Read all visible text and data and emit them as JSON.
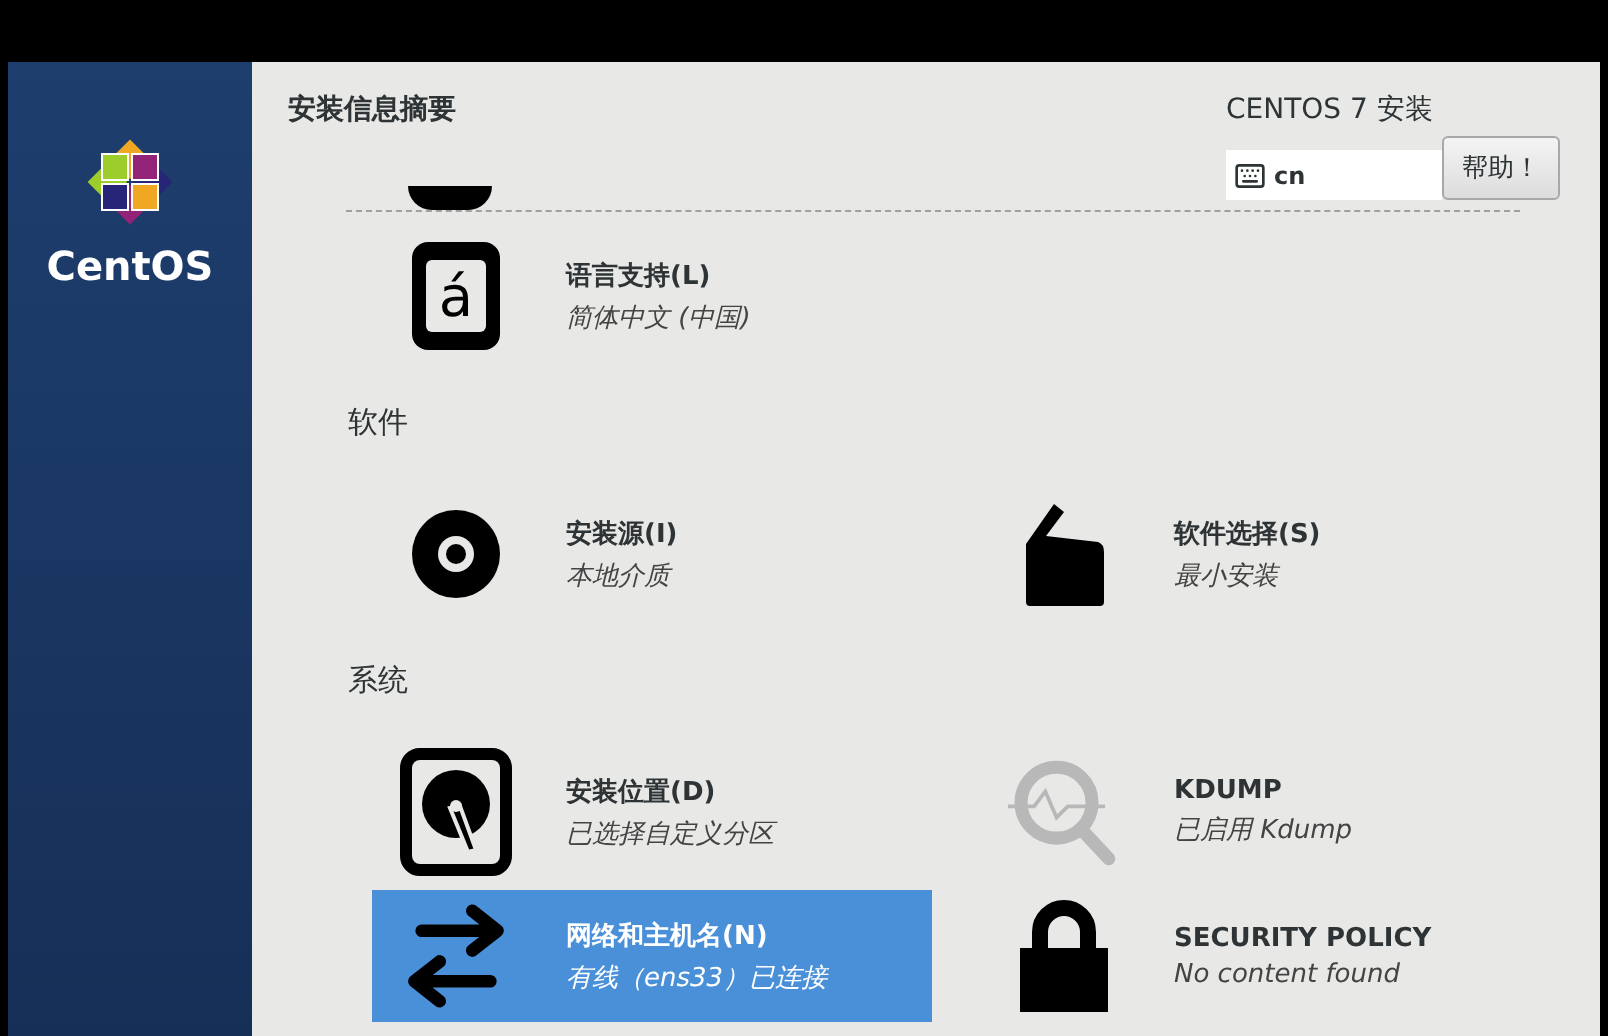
{
  "sidebar": {
    "logo_text": "CentOS"
  },
  "header": {
    "title": "安装信息摘要",
    "product": "CENTOS 7 安装",
    "keyboard": "cn",
    "help_button": "帮助！"
  },
  "sections": [
    {
      "spokes": [
        {
          "kind": "language",
          "glyph": "á",
          "title": "语言支持(L)",
          "status": "简体中文 (中国)",
          "selected": false
        }
      ]
    },
    {
      "heading": "软件",
      "spokes": [
        {
          "kind": "disc",
          "title": "安装源(I)",
          "status": "本地介质",
          "selected": false
        },
        {
          "kind": "package",
          "title": "软件选择(S)",
          "status": "最小安装",
          "selected": false
        }
      ]
    },
    {
      "heading": "系统",
      "spokes": [
        {
          "kind": "disk",
          "title": "安装位置(D)",
          "status": "已选择自定义分区",
          "selected": false
        },
        {
          "kind": "kdump",
          "title": "KDUMP",
          "status": "已启用 Kdump",
          "selected": false
        },
        {
          "kind": "network",
          "title": "网络和主机名(N)",
          "status": "有线（ens33）已连接",
          "selected": true
        },
        {
          "kind": "lock",
          "title": "SECURITY POLICY",
          "status": "No content found",
          "selected": false
        }
      ]
    }
  ]
}
